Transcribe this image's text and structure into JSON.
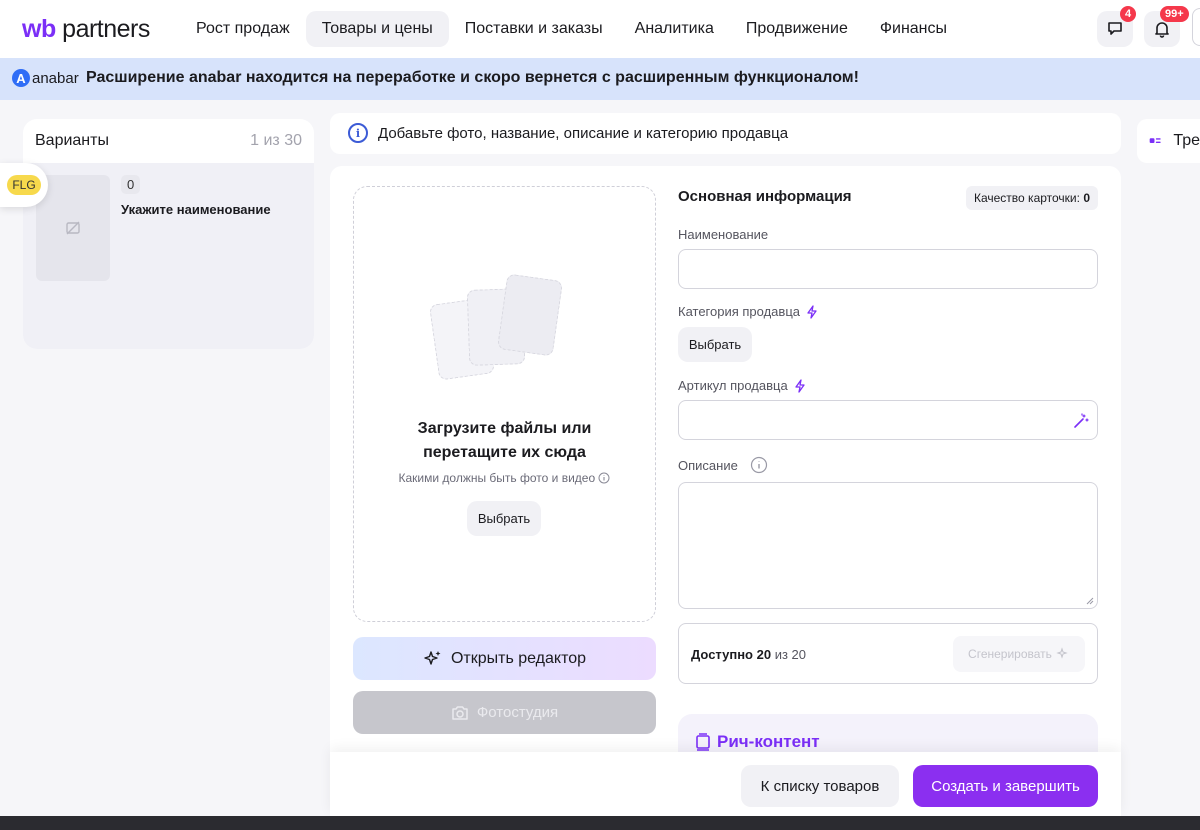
{
  "app": {
    "logo_wb": "wb",
    "logo_rest": " partners",
    "nav": [
      {
        "label": "Рост продаж",
        "active": false
      },
      {
        "label": "Товары и цены",
        "active": true
      },
      {
        "label": "Поставки и заказы",
        "active": false
      },
      {
        "label": "Аналитика",
        "active": false
      },
      {
        "label": "Продвижение",
        "active": false
      },
      {
        "label": "Финансы",
        "active": false
      }
    ],
    "chat_badge": "4",
    "notif_badge": "99+"
  },
  "banner": {
    "logo_letter": "A",
    "logo_text": "anabar",
    "text": "Расширение anabar находится на переработке и скоро вернется с расширенным функционалом!"
  },
  "variants": {
    "title": "Варианты",
    "count": "1 из 30",
    "item_number": "0",
    "item_name": "Укажите наименование",
    "flag_label": "FLG"
  },
  "info": {
    "text": "Добавьте фото, название, описание и категорию продавца"
  },
  "right_panel": {
    "label": "Тре"
  },
  "upload": {
    "title_line1": "Загрузите файлы или",
    "title_line2": "перетащите их сюда",
    "subtitle": "Какими должны быть фото и видео",
    "choose_label": "Выбрать",
    "editor_label": "Открыть редактор",
    "studio_label": "Фотостудия"
  },
  "form": {
    "title": "Основная информация",
    "quality_label": "Качество карточки:",
    "quality_value": "0",
    "name_label": "Наименование",
    "name_value": "",
    "category_label": "Категория продавца",
    "category_button": "Выбрать",
    "article_label": "Артикул продавца",
    "article_value": "",
    "description_label": "Описание",
    "description_value": "",
    "available_label": "Доступно",
    "available_value": "20",
    "available_of": "из 20",
    "generate_label": "Сгенерировать",
    "rich_label": "Рич-контент"
  },
  "footer": {
    "back_label": "К списку товаров",
    "create_label": "Создать и завершить"
  },
  "colors": {
    "accent": "#8b2ff0",
    "banner_bg": "#d7e3fb",
    "badge": "#f5384b"
  }
}
